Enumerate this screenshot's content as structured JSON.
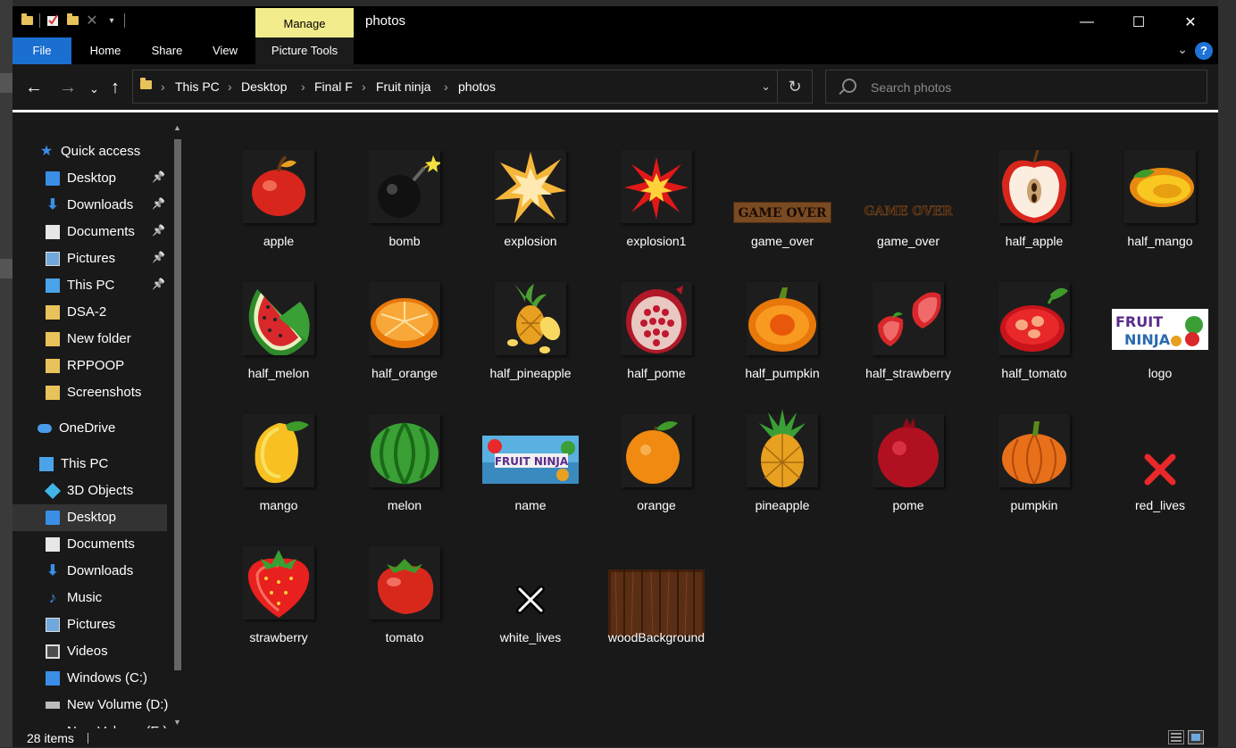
{
  "window": {
    "title": "photos",
    "context_tab": "Manage",
    "controls": {
      "minimize": "—",
      "maximize": "☐",
      "close": "✕"
    }
  },
  "ribbon": {
    "tabs": [
      "File",
      "Home",
      "Share",
      "View",
      "Picture Tools"
    ],
    "help": "?",
    "chevron": "⌄"
  },
  "nav": {
    "back": "←",
    "forward": "→",
    "recent": "⌄",
    "up": "↑",
    "breadcrumb": [
      "This PC",
      "Desktop",
      "Final F",
      "Fruit ninja",
      "photos"
    ],
    "separator": "›",
    "dropdown": "⌄",
    "refresh": "↻"
  },
  "search": {
    "placeholder": "Search photos",
    "value": ""
  },
  "sidebar": {
    "items": [
      {
        "label": "Quick access",
        "icon": "star-icon",
        "pinned": false
      },
      {
        "label": "Desktop",
        "icon": "desktop-icon",
        "pinned": true
      },
      {
        "label": "Downloads",
        "icon": "download-icon",
        "pinned": true
      },
      {
        "label": "Documents",
        "icon": "documents-icon",
        "pinned": true
      },
      {
        "label": "Pictures",
        "icon": "pictures-icon",
        "pinned": true
      },
      {
        "label": "This PC",
        "icon": "pc-icon",
        "pinned": true
      },
      {
        "label": "DSA-2",
        "icon": "folder-icon",
        "pinned": false
      },
      {
        "label": "New folder",
        "icon": "folder-icon",
        "pinned": false
      },
      {
        "label": "RPPOOP",
        "icon": "folder-icon",
        "pinned": false
      },
      {
        "label": "Screenshots",
        "icon": "folder-icon",
        "pinned": false
      },
      {
        "label": "OneDrive",
        "icon": "cloud-icon",
        "pinned": false
      },
      {
        "label": "This PC",
        "icon": "pc-icon",
        "pinned": false
      },
      {
        "label": "3D Objects",
        "icon": "3d-objects-icon",
        "pinned": false
      },
      {
        "label": "Desktop",
        "icon": "desktop-icon",
        "pinned": false,
        "selected": true
      },
      {
        "label": "Documents",
        "icon": "documents-icon",
        "pinned": false
      },
      {
        "label": "Downloads",
        "icon": "download-icon",
        "pinned": false
      },
      {
        "label": "Music",
        "icon": "music-icon",
        "pinned": false
      },
      {
        "label": "Pictures",
        "icon": "pictures-icon",
        "pinned": false
      },
      {
        "label": "Videos",
        "icon": "videos-icon",
        "pinned": false
      },
      {
        "label": "Windows (C:)",
        "icon": "windows-drive-icon",
        "pinned": false
      },
      {
        "label": "New Volume (D:)",
        "icon": "drive-icon",
        "pinned": false
      },
      {
        "label": "New Volume (E:)",
        "icon": "drive-icon",
        "pinned": false
      }
    ]
  },
  "files": [
    {
      "name": "apple",
      "thumb": "apple"
    },
    {
      "name": "bomb",
      "thumb": "bomb"
    },
    {
      "name": "explosion",
      "thumb": "explosion"
    },
    {
      "name": "explosion1",
      "thumb": "explosion-red"
    },
    {
      "name": "game_over",
      "thumb": "game-over-banner"
    },
    {
      "name": "game_over",
      "thumb": "game-over-dark"
    },
    {
      "name": "half_apple",
      "thumb": "half-apple"
    },
    {
      "name": "half_mango",
      "thumb": "half-mango"
    },
    {
      "name": "half_melon",
      "thumb": "half-melon"
    },
    {
      "name": "half_orange",
      "thumb": "half-orange"
    },
    {
      "name": "half_pineapple",
      "thumb": "half-pineapple"
    },
    {
      "name": "half_pome",
      "thumb": "half-pome"
    },
    {
      "name": "half_pumpkin",
      "thumb": "half-pumpkin"
    },
    {
      "name": "half_strawberry",
      "thumb": "half-strawberry"
    },
    {
      "name": "half_tomato",
      "thumb": "half-tomato"
    },
    {
      "name": "logo",
      "thumb": "logo"
    },
    {
      "name": "mango",
      "thumb": "mango"
    },
    {
      "name": "melon",
      "thumb": "melon"
    },
    {
      "name": "name",
      "thumb": "name-banner"
    },
    {
      "name": "orange",
      "thumb": "orange"
    },
    {
      "name": "pineapple",
      "thumb": "pineapple"
    },
    {
      "name": "pome",
      "thumb": "pome"
    },
    {
      "name": "pumpkin",
      "thumb": "pumpkin"
    },
    {
      "name": "red_lives",
      "thumb": "red-x"
    },
    {
      "name": "strawberry",
      "thumb": "strawberry"
    },
    {
      "name": "tomato",
      "thumb": "tomato"
    },
    {
      "name": "white_lives",
      "thumb": "white-x"
    },
    {
      "name": "woodBackground",
      "thumb": "wood"
    }
  ],
  "status": {
    "item_count": "28 items"
  },
  "colors": {
    "accent": "#1a6fd0",
    "manage_tab": "#f2ec8c",
    "background": "#191919"
  }
}
